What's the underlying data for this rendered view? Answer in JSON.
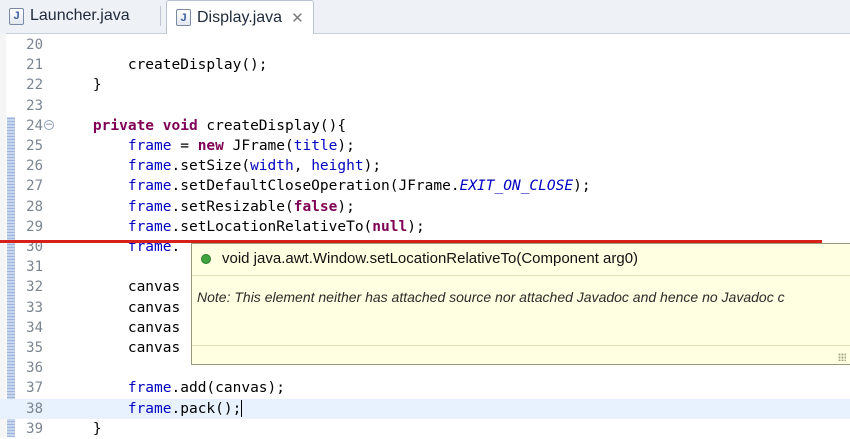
{
  "tabs": [
    {
      "label": "Launcher.java",
      "icon": "java-file-icon",
      "active": false
    },
    {
      "label": "Display.java",
      "icon": "java-file-icon",
      "active": true,
      "close": "✕"
    }
  ],
  "editor": {
    "lines": [
      {
        "num": "20",
        "text": ""
      },
      {
        "num": "21",
        "text": "        createDisplay();"
      },
      {
        "num": "22",
        "text": "    }"
      },
      {
        "num": "23",
        "text": ""
      },
      {
        "num": "24",
        "text": "    private void createDisplay(){"
      },
      {
        "num": "25",
        "text": "        frame = new JFrame(title);"
      },
      {
        "num": "26",
        "text": "        frame.setSize(width, height);"
      },
      {
        "num": "27",
        "text": "        frame.setDefaultCloseOperation(JFrame.EXIT_ON_CLOSE);"
      },
      {
        "num": "28",
        "text": "        frame.setResizable(false);"
      },
      {
        "num": "29",
        "text": "        frame.setLocationRelativeTo(null);"
      },
      {
        "num": "30",
        "text": "        frame."
      },
      {
        "num": "31",
        "text": ""
      },
      {
        "num": "32",
        "text": "        canvas"
      },
      {
        "num": "33",
        "text": "        canvas"
      },
      {
        "num": "34",
        "text": "        canvas"
      },
      {
        "num": "35",
        "text": "        canvas"
      },
      {
        "num": "36",
        "text": ""
      },
      {
        "num": "37",
        "text": "        frame.add(canvas);"
      },
      {
        "num": "38",
        "text": "        frame.pack();"
      },
      {
        "num": "39",
        "text": "    }"
      }
    ]
  },
  "tooltip": {
    "signature": "void java.awt.Window.setLocationRelativeTo(Component arg0)",
    "note": "Note: This element neither has attached source nor attached Javadoc and hence no Javadoc c"
  },
  "colors": {
    "keyword": "#7f0055",
    "field": "#0000c0",
    "annotation_line": "#d8201a",
    "tooltip_bg": "#ffffe1"
  }
}
